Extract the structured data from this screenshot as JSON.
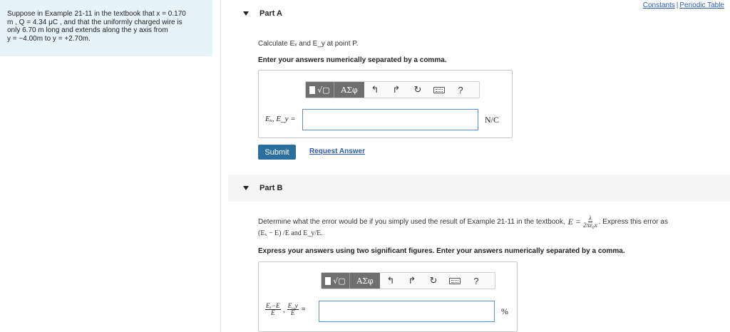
{
  "top_links": {
    "constants": "Constants",
    "separator": "|",
    "periodic_table": "Periodic Table"
  },
  "problem": {
    "line1": "Suppose in Example 21-11 in the textbook that x = 0.170",
    "line2": "m , Q = 4.34 μC , and that the uniformly charged wire is",
    "line3": "only 6.70 m long and extends along the y axis from",
    "line4": "y = −4.00m to y = +2.70m."
  },
  "partA": {
    "title": "Part A",
    "question": "Calculate Eₓ and E_y at point P.",
    "instruction": "Enter your answers numerically separated by a comma.",
    "answer_label": "Eₓ, E_y =",
    "answer_value": "",
    "unit": "N/C",
    "submit": "Submit",
    "request": "Request Answer"
  },
  "partB": {
    "title": "Part B",
    "question_pre": "Determine what the error would be if you simply used the result of Example 21-11 in the textbook,",
    "formula_lhs": "E =",
    "formula_num": "λ",
    "formula_den": "2πε₀x",
    "question_post": ". Express this error as",
    "question_line2": "(Eₓ − E) /E and E_y/E.",
    "instruction": "Express your answers using two significant figures. Enter your answers numerically separated by a comma.",
    "label_frac1_num": "Eₓ−E",
    "label_frac1_den": "E",
    "label_frac2_num": "E_y",
    "label_frac2_den": "E",
    "label_eq": "=",
    "answer_value": "",
    "unit": "%"
  },
  "toolbar": {
    "matrix_icon": "√▢",
    "greek": "ΑΣφ",
    "undo": "↰",
    "redo": "↱",
    "reset": "↻",
    "help": "?"
  }
}
